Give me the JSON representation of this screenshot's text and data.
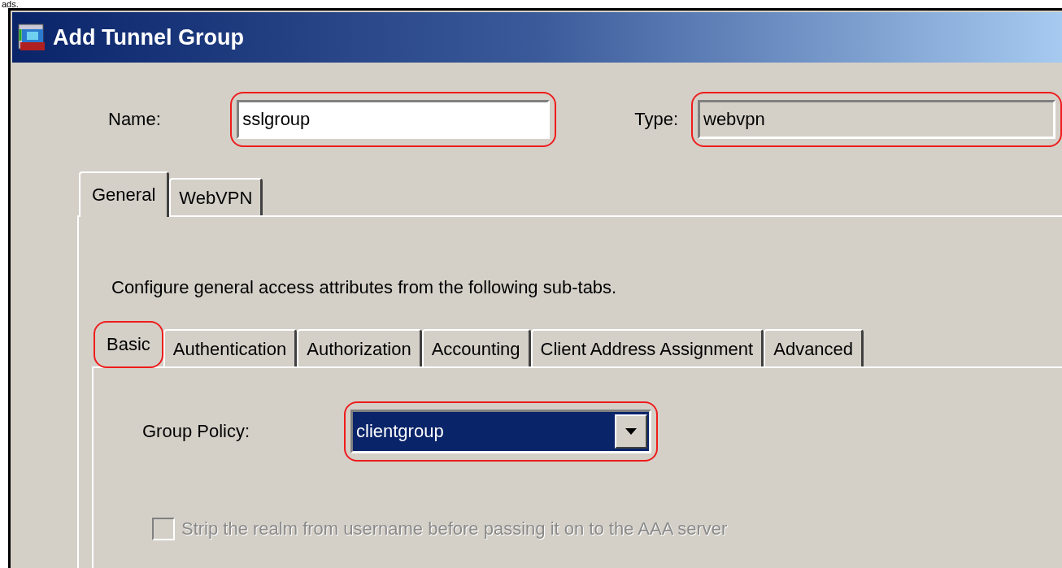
{
  "caption": "ads.",
  "window": {
    "title": "Add Tunnel Group"
  },
  "name_field": {
    "label": "Name:",
    "value": "sslgroup",
    "disabled": false,
    "highlighted": true
  },
  "type_field": {
    "label": "Type:",
    "value": "webvpn",
    "disabled": true,
    "highlighted": true
  },
  "tabs": [
    {
      "label": "General",
      "selected": true,
      "highlighted": false
    },
    {
      "label": "WebVPN",
      "selected": false,
      "highlighted": false
    }
  ],
  "description": "Configure general access attributes from the following sub-tabs.",
  "sub_tabs": [
    {
      "label": "Basic",
      "selected": true,
      "highlighted": true
    },
    {
      "label": "Authentication",
      "selected": false,
      "highlighted": false
    },
    {
      "label": "Authorization",
      "selected": false,
      "highlighted": false
    },
    {
      "label": "Accounting",
      "selected": false,
      "highlighted": false
    },
    {
      "label": "Client Address Assignment",
      "selected": false,
      "highlighted": false
    },
    {
      "label": "Advanced",
      "selected": false,
      "highlighted": false
    }
  ],
  "group_policy": {
    "label": "Group Policy:",
    "value": "clientgroup",
    "focused": true,
    "highlighted": true
  },
  "strip_realm": {
    "label": "Strip the realm from username before passing it on to the AAA server",
    "checked": false,
    "disabled": true
  }
}
